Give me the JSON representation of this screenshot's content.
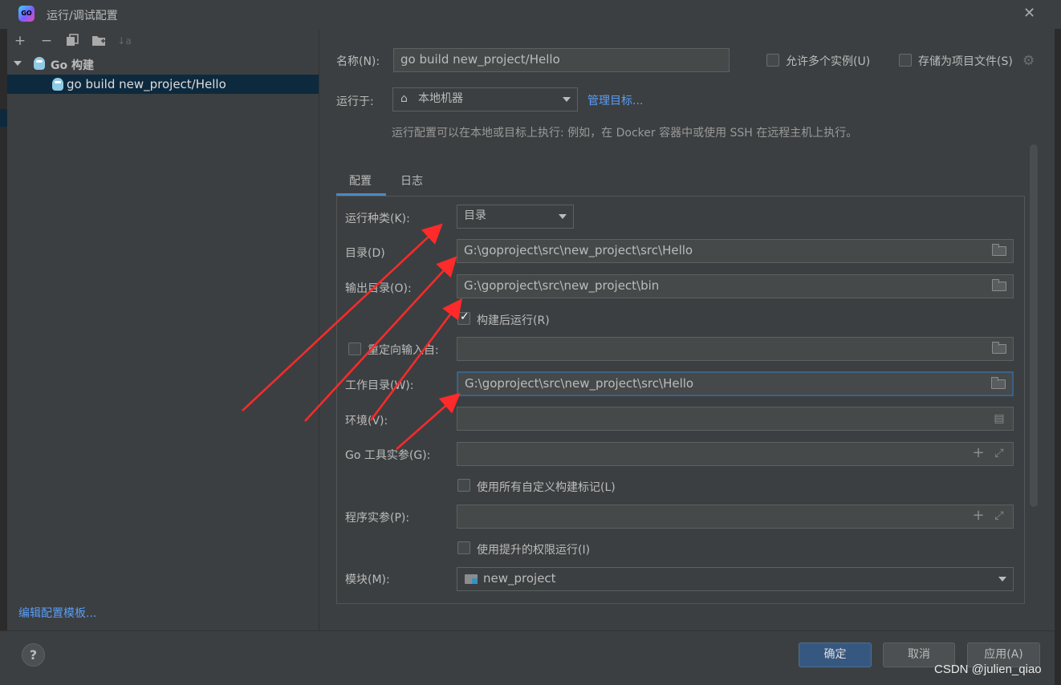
{
  "window": {
    "title": "运行/调试配置",
    "app_icon_text": "GO"
  },
  "left_panel": {
    "tree": {
      "root_label": "Go 构建",
      "child_label": "go build new_project/Hello"
    },
    "edit_templates_link": "编辑配置模板..."
  },
  "header": {
    "name_label": "名称(N):",
    "name_value": "go build new_project/Hello",
    "allow_multiple_label": "允许多个实例(U)",
    "store_as_project_label": "存储为项目文件(S)",
    "run_on_label": "运行于:",
    "run_on_value": "本地机器",
    "manage_targets_link": "管理目标...",
    "run_on_hint": "运行配置可以在本地或目标上执行: 例如，在 Docker 容器中或使用 SSH 在远程主机上执行。"
  },
  "tabs": [
    {
      "label": "配置",
      "active": true
    },
    {
      "label": "日志",
      "active": false
    }
  ],
  "config": {
    "run_kind_label": "运行种类(K):",
    "run_kind_value": "目录",
    "directory_label": "目录(D)",
    "directory_value": "G:\\goproject\\src\\new_project\\src\\Hello",
    "output_dir_label": "输出目录(O):",
    "output_dir_value": "G:\\goproject\\src\\new_project\\bin",
    "run_after_build_label": "构建后运行(R)",
    "run_after_build_checked": true,
    "redirect_input_label": "重定向输入自:",
    "redirect_input_checked": false,
    "redirect_input_value": "",
    "working_dir_label": "工作目录(W):",
    "working_dir_value": "G:\\goproject\\src\\new_project\\src\\Hello",
    "env_label": "环境(V):",
    "env_value": "",
    "go_tool_args_label": "Go 工具实参(G):",
    "go_tool_args_value": "",
    "use_all_custom_tags_label": "使用所有自定义构建标记(L)",
    "use_all_custom_tags_checked": false,
    "program_args_label": "程序实参(P):",
    "program_args_value": "",
    "run_elevated_label": "使用提升的权限运行(I)",
    "run_elevated_checked": false,
    "module_label": "模块(M):",
    "module_value": "new_project"
  },
  "footer": {
    "help_label": "?",
    "ok_label": "确定",
    "cancel_label": "取消",
    "apply_label": "应用(A)"
  },
  "watermark": "CSDN @julien_qiao",
  "colors": {
    "accent": "#4a88c7",
    "link": "#589df6",
    "selection": "#0d293e",
    "primary_button": "#365880",
    "annotation_arrow": "#ff2a2a"
  }
}
